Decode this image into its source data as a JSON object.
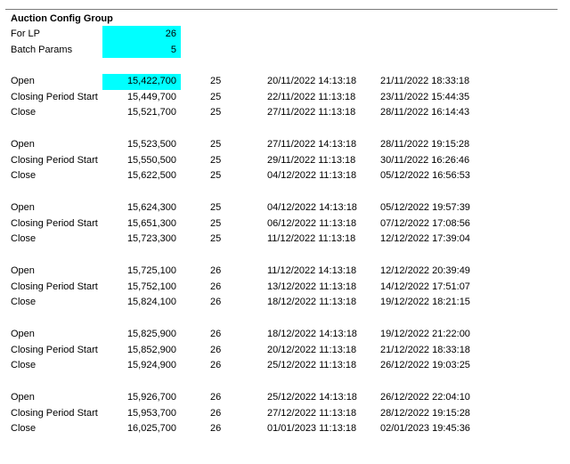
{
  "title": "Auction Config Group",
  "params": [
    {
      "label": "For LP",
      "value": "26"
    },
    {
      "label": "Batch Params",
      "value": "5"
    }
  ],
  "sections": [
    {
      "rows": [
        {
          "label": "Open",
          "price": "15,422,700",
          "n": "25",
          "start": "20/11/2022 14:13:18",
          "end": "21/11/2022 18:33:18",
          "highlight": true
        },
        {
          "label": "Closing Period Start",
          "price": "15,449,700",
          "n": "25",
          "start": "22/11/2022 11:13:18",
          "end": "23/11/2022 15:44:35"
        },
        {
          "label": "Close",
          "price": "15,521,700",
          "n": "25",
          "start": "27/11/2022 11:13:18",
          "end": "28/11/2022 16:14:43"
        }
      ]
    },
    {
      "rows": [
        {
          "label": "Open",
          "price": "15,523,500",
          "n": "25",
          "start": "27/11/2022 14:13:18",
          "end": "28/11/2022 19:15:28"
        },
        {
          "label": "Closing Period Start",
          "price": "15,550,500",
          "n": "25",
          "start": "29/11/2022 11:13:18",
          "end": "30/11/2022 16:26:46"
        },
        {
          "label": "Close",
          "price": "15,622,500",
          "n": "25",
          "start": "04/12/2022 11:13:18",
          "end": "05/12/2022 16:56:53"
        }
      ]
    },
    {
      "rows": [
        {
          "label": "Open",
          "price": "15,624,300",
          "n": "25",
          "start": "04/12/2022 14:13:18",
          "end": "05/12/2022 19:57:39"
        },
        {
          "label": "Closing Period Start",
          "price": "15,651,300",
          "n": "25",
          "start": "06/12/2022 11:13:18",
          "end": "07/12/2022 17:08:56"
        },
        {
          "label": "Close",
          "price": "15,723,300",
          "n": "25",
          "start": "11/12/2022 11:13:18",
          "end": "12/12/2022 17:39:04"
        }
      ]
    },
    {
      "rows": [
        {
          "label": "Open",
          "price": "15,725,100",
          "n": "26",
          "start": "11/12/2022 14:13:18",
          "end": "12/12/2022 20:39:49"
        },
        {
          "label": "Closing Period Start",
          "price": "15,752,100",
          "n": "26",
          "start": "13/12/2022 11:13:18",
          "end": "14/12/2022 17:51:07"
        },
        {
          "label": "Close",
          "price": "15,824,100",
          "n": "26",
          "start": "18/12/2022 11:13:18",
          "end": "19/12/2022 18:21:15"
        }
      ]
    },
    {
      "rows": [
        {
          "label": "Open",
          "price": "15,825,900",
          "n": "26",
          "start": "18/12/2022 14:13:18",
          "end": "19/12/2022 21:22:00"
        },
        {
          "label": "Closing Period Start",
          "price": "15,852,900",
          "n": "26",
          "start": "20/12/2022 11:13:18",
          "end": "21/12/2022 18:33:18"
        },
        {
          "label": "Close",
          "price": "15,924,900",
          "n": "26",
          "start": "25/12/2022 11:13:18",
          "end": "26/12/2022 19:03:25"
        }
      ]
    },
    {
      "rows": [
        {
          "label": "Open",
          "price": "15,926,700",
          "n": "26",
          "start": "25/12/2022 14:13:18",
          "end": "26/12/2022 22:04:10"
        },
        {
          "label": "Closing Period Start",
          "price": "15,953,700",
          "n": "26",
          "start": "27/12/2022 11:13:18",
          "end": "28/12/2022 19:15:28"
        },
        {
          "label": "Close",
          "price": "16,025,700",
          "n": "26",
          "start": "01/01/2023 11:13:18",
          "end": "02/01/2023 19:45:36"
        }
      ]
    }
  ],
  "colors": {
    "highlight": "#00ffff",
    "rule": "#7a7a7a"
  }
}
